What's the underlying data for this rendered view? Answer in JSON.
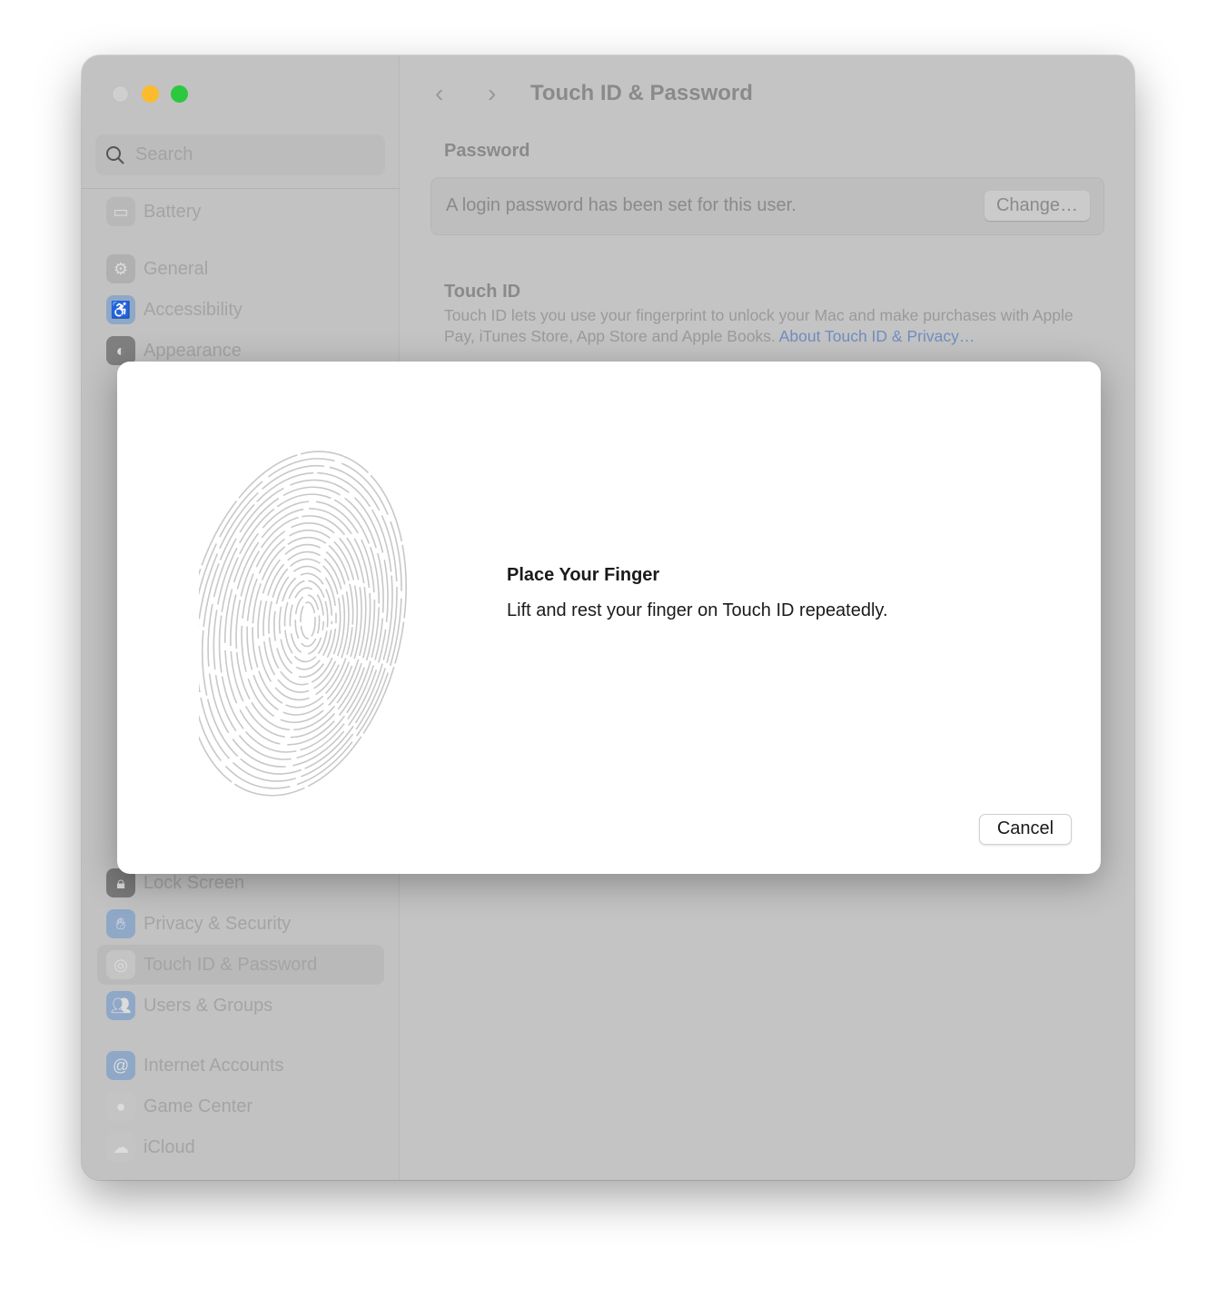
{
  "window": {
    "title": "Touch ID & Password",
    "traffic_colors": [
      "#d0d0d0",
      "#fcbb2e",
      "#2bc840"
    ]
  },
  "sidebar": {
    "search_placeholder": "Search",
    "items": [
      {
        "label": "Battery",
        "icon": "battery-icon",
        "color": "#b8b8b8"
      },
      {
        "label": "General",
        "icon": "gear-icon",
        "color": "#b0b0b0"
      },
      {
        "label": "Accessibility",
        "icon": "accessibility-icon",
        "color": "#8fa8c8"
      },
      {
        "label": "Appearance",
        "icon": "appearance-icon",
        "color": "#808080"
      },
      {
        "label": "Lock Screen",
        "icon": "lock-icon",
        "color": "#7a7a7a"
      },
      {
        "label": "Privacy & Security",
        "icon": "hand-icon",
        "color": "#8fa8c8"
      },
      {
        "label": "Touch ID & Password",
        "icon": "fingerprint-icon",
        "color": "#c4c4c4",
        "selected": true
      },
      {
        "label": "Users & Groups",
        "icon": "users-icon",
        "color": "#8fa8c8"
      },
      {
        "label": "Internet Accounts",
        "icon": "at-icon",
        "color": "#8fa8c8"
      },
      {
        "label": "Game Center",
        "icon": "game-center-icon",
        "color": "#c4c4c4"
      },
      {
        "label": "iCloud",
        "icon": "cloud-icon",
        "color": "#c4c4c4"
      }
    ]
  },
  "main": {
    "password_heading": "Password",
    "password_status": "A login password has been set for this user.",
    "change_button": "Change…",
    "touchid_heading": "Touch ID",
    "touchid_desc": "Touch ID lets you use your fingerprint to unlock your Mac and make purchases with Apple Pay, iTunes Store, App Store and Apple Books.",
    "touchid_link": "About Touch ID & Privacy…"
  },
  "dialog": {
    "title": "Place Your Finger",
    "message": "Lift and rest your finger on Touch ID repeatedly.",
    "cancel_button": "Cancel",
    "icon": "fingerprint-icon"
  }
}
